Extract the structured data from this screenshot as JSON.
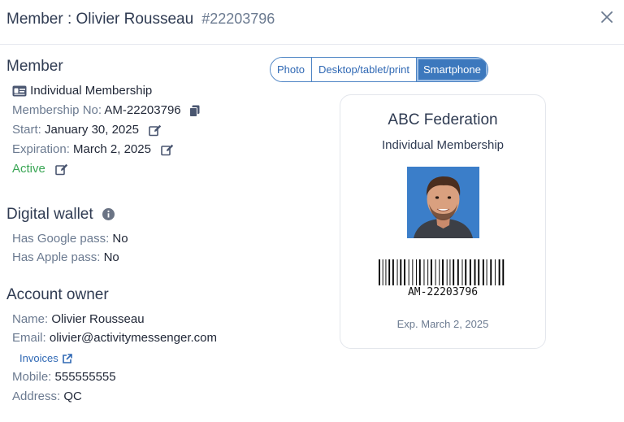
{
  "header": {
    "title": "Member : Olivier Rousseau",
    "member_id": "#22203796"
  },
  "member": {
    "section_title": "Member",
    "membership_type": "Individual Membership",
    "membership_no_label": "Membership No:",
    "membership_no": "AM-22203796",
    "start_label": "Start:",
    "start": "January 30, 2025",
    "expiration_label": "Expiration:",
    "expiration": "March 2, 2025",
    "status": "Active"
  },
  "wallet": {
    "section_title": "Digital wallet",
    "google_label": "Has Google pass:",
    "google": "No",
    "apple_label": "Has Apple pass:",
    "apple": "No"
  },
  "owner": {
    "section_title": "Account owner",
    "name_label": "Name:",
    "name": "Olivier Rousseau",
    "email_label": "Email:",
    "email": "olivier@activitymessenger.com",
    "invoices_link": "Invoices",
    "mobile_label": "Mobile:",
    "mobile": "555555555",
    "address_label": "Address:",
    "address": "QC"
  },
  "view_toggle": {
    "options": [
      "Photo",
      "Desktop/tablet/print",
      "Smartphone"
    ],
    "selected": "Smartphone"
  },
  "card": {
    "organization": "ABC Federation",
    "membership_type": "Individual Membership",
    "barcode_value": "AM-22203796",
    "expiry_text": "Exp. March 2, 2025"
  },
  "colors": {
    "accent": "#3c78bd",
    "active_green": "#3aa655",
    "label_gray": "#6b7a90",
    "photo_bg": "#3b7ec9"
  },
  "icons": {
    "close": "close-icon",
    "id_card": "id-card-icon",
    "copy": "copy-icon",
    "edit": "edit-icon",
    "info": "info-icon",
    "external_link": "external-link-icon"
  }
}
